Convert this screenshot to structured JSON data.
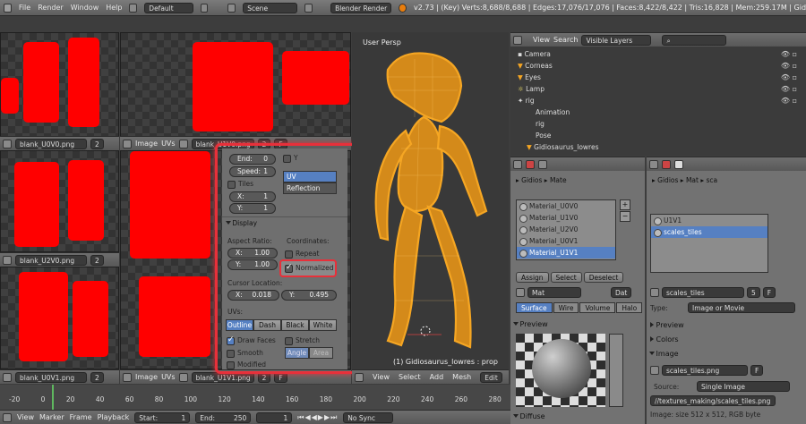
{
  "topbar": {
    "menus": [
      "File",
      "Render",
      "Window",
      "Help"
    ],
    "layout": "Default",
    "scene": "Scene",
    "engine": "Blender Render",
    "stats": "v2.73 | (Key) Verts:8,688/8,688 | Edges:17,076/17,076 | Faces:8,422/8,422 | Tris:16,828 | Mem:259.17M | Gid"
  },
  "uv_editors": [
    {
      "image": "blank_U0V0.png",
      "users": "2"
    },
    {
      "image": "blank_U1V0.png",
      "users": "2",
      "image_menu": "Image",
      "uvs_menu": "UVs"
    },
    {
      "image": "blank_U2V0.png",
      "users": "2"
    },
    {
      "image": "blank_U0V1.png",
      "users": "2"
    },
    {
      "image": "blank_U1V1.png",
      "users": "2",
      "image_menu": "Image",
      "uvs_menu": "UVs"
    }
  ],
  "f_label": "F",
  "uvpanel": {
    "end_label": "End:",
    "end_val": "0",
    "speed_label": "Speed:",
    "speed_val": "1",
    "tiles_label": "Tiles",
    "x_label": "X:",
    "x_val": "1",
    "y_label": "Y:",
    "y_val": "1",
    "y_toggle": "Y",
    "uv_coords": "UV Coordinates",
    "reflection": "Reflection",
    "display_header": "Display",
    "aspect_label": "Aspect Ratio:",
    "aspect_x_label": "X:",
    "aspect_x": "1.00",
    "aspect_y_label": "Y:",
    "aspect_y": "1.00",
    "coords_label": "Coordinates:",
    "repeat": "Repeat",
    "normalized": "Normalized",
    "cursor_label": "Cursor Location:",
    "cursor_x_label": "X:",
    "cursor_x": "0.018",
    "cursor_y_label": "Y:",
    "cursor_y": "0.495",
    "uvs_label": "UVs:",
    "outline": "Outline",
    "dash": "Dash",
    "black": "Black",
    "white": "White",
    "draw_faces": "Draw Faces",
    "stretch": "Stretch",
    "smooth": "Smooth",
    "angle": "Angle",
    "area": "Area",
    "modified": "Modified"
  },
  "viewport": {
    "title": "User Persp",
    "object_label": "(1) Gidiosaurus_lowres : prop",
    "menus": [
      "View",
      "Select",
      "Add",
      "Mesh"
    ],
    "edit": "Edit"
  },
  "outliner": {
    "menus": [
      "View",
      "Search"
    ],
    "filter": "Visible Layers",
    "items": [
      "Camera",
      "Corneas",
      "Eyes",
      "Lamp",
      "rig",
      "Animation",
      "rig",
      "Pose",
      "Gidiosaurus_lowres"
    ]
  },
  "material": {
    "breadcrumb": [
      "Gidios",
      "Mate"
    ],
    "slots": [
      "Material_U0V0",
      "Material_U1V0",
      "Material_U2V0",
      "Material_U0V1",
      "Material_U1V1"
    ],
    "assign": "Assign",
    "select": "Select",
    "deselect": "Deselect",
    "name_prefix": "Mat",
    "tabs": [
      "Surface",
      "Wire",
      "Volume",
      "Halo"
    ],
    "preview": "Preview",
    "diffuse": "Diffuse",
    "dat": "Dat"
  },
  "texture": {
    "breadcrumb": [
      "Gidios",
      "Mat",
      "sca"
    ],
    "slots": [
      "U1V1",
      "scales_tiles"
    ],
    "name": "scales_tiles",
    "users": "5",
    "type_label": "Type:",
    "type": "Image or Movie",
    "preview": "Preview",
    "colors": "Colors",
    "image": "Image",
    "image_name": "scales_tiles.png",
    "source_label": "Source:",
    "source": "Single Image",
    "path": "//textures_making/scales_tiles.png",
    "info": "Image: size 512 x 512, RGB byte"
  },
  "timeline": {
    "ticks": [
      "-20",
      "0",
      "20",
      "40",
      "60",
      "80",
      "100",
      "120",
      "140",
      "160",
      "180",
      "200",
      "220",
      "240",
      "260",
      "280"
    ],
    "menus": [
      "View",
      "Marker",
      "Frame",
      "Playback"
    ],
    "start_label": "Start:",
    "start": "1",
    "end_label": "End:",
    "end": "250",
    "current": "1",
    "sync": "No Sync"
  },
  "colors": {
    "accent": "#5680c2",
    "highlight": "#e8303a",
    "wire": "#f5a623"
  }
}
